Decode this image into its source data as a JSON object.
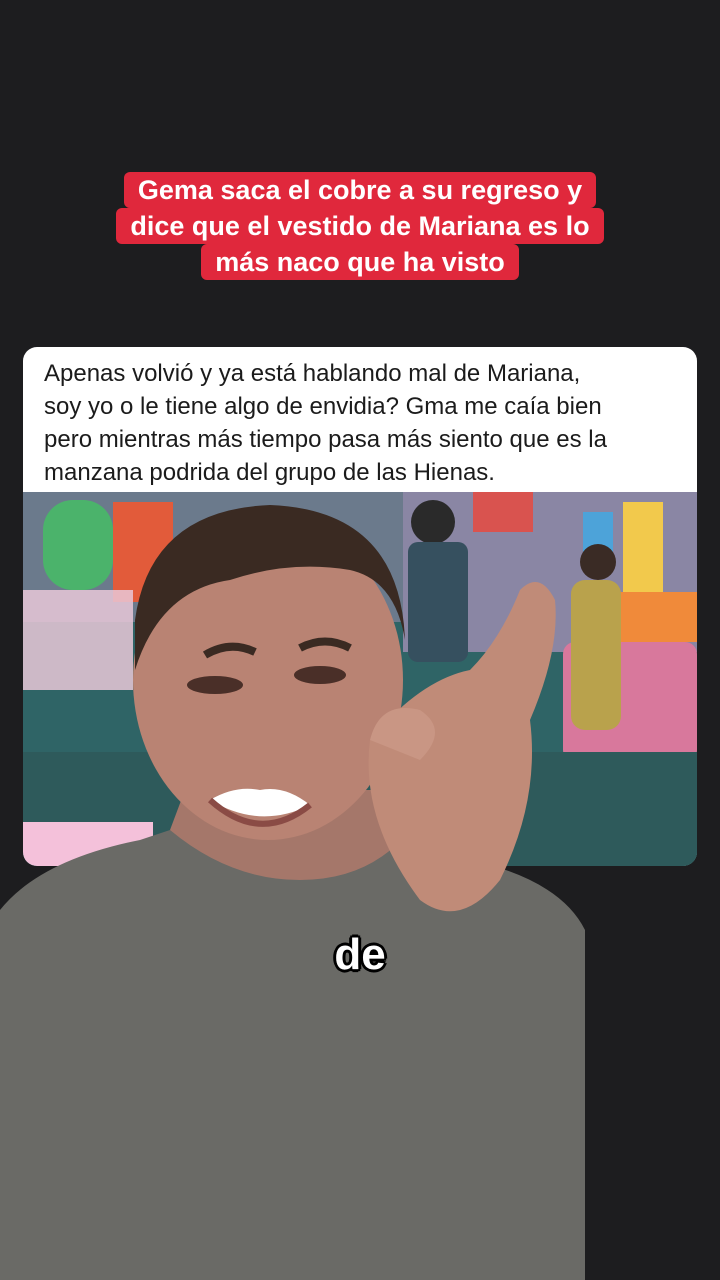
{
  "headline": {
    "lines": [
      "Gema saca el cobre a su regreso y",
      "dice que el vestido de Mariana es lo",
      "más naco que ha visto"
    ]
  },
  "post": {
    "text_lines": [
      "Apenas volvió y ya está hablando mal de Mariana,",
      "soy yo o le tiene algo de envidia? Gma me caía bien",
      "pero mientras más tiempo pasa más siento que es la",
      "manzana podrida del grupo de las Hienas."
    ]
  },
  "caption": {
    "text": "de"
  },
  "colors": {
    "background": "#1d1d1f",
    "headline_bg": "#e0283c",
    "card_bg": "#ffffff"
  }
}
